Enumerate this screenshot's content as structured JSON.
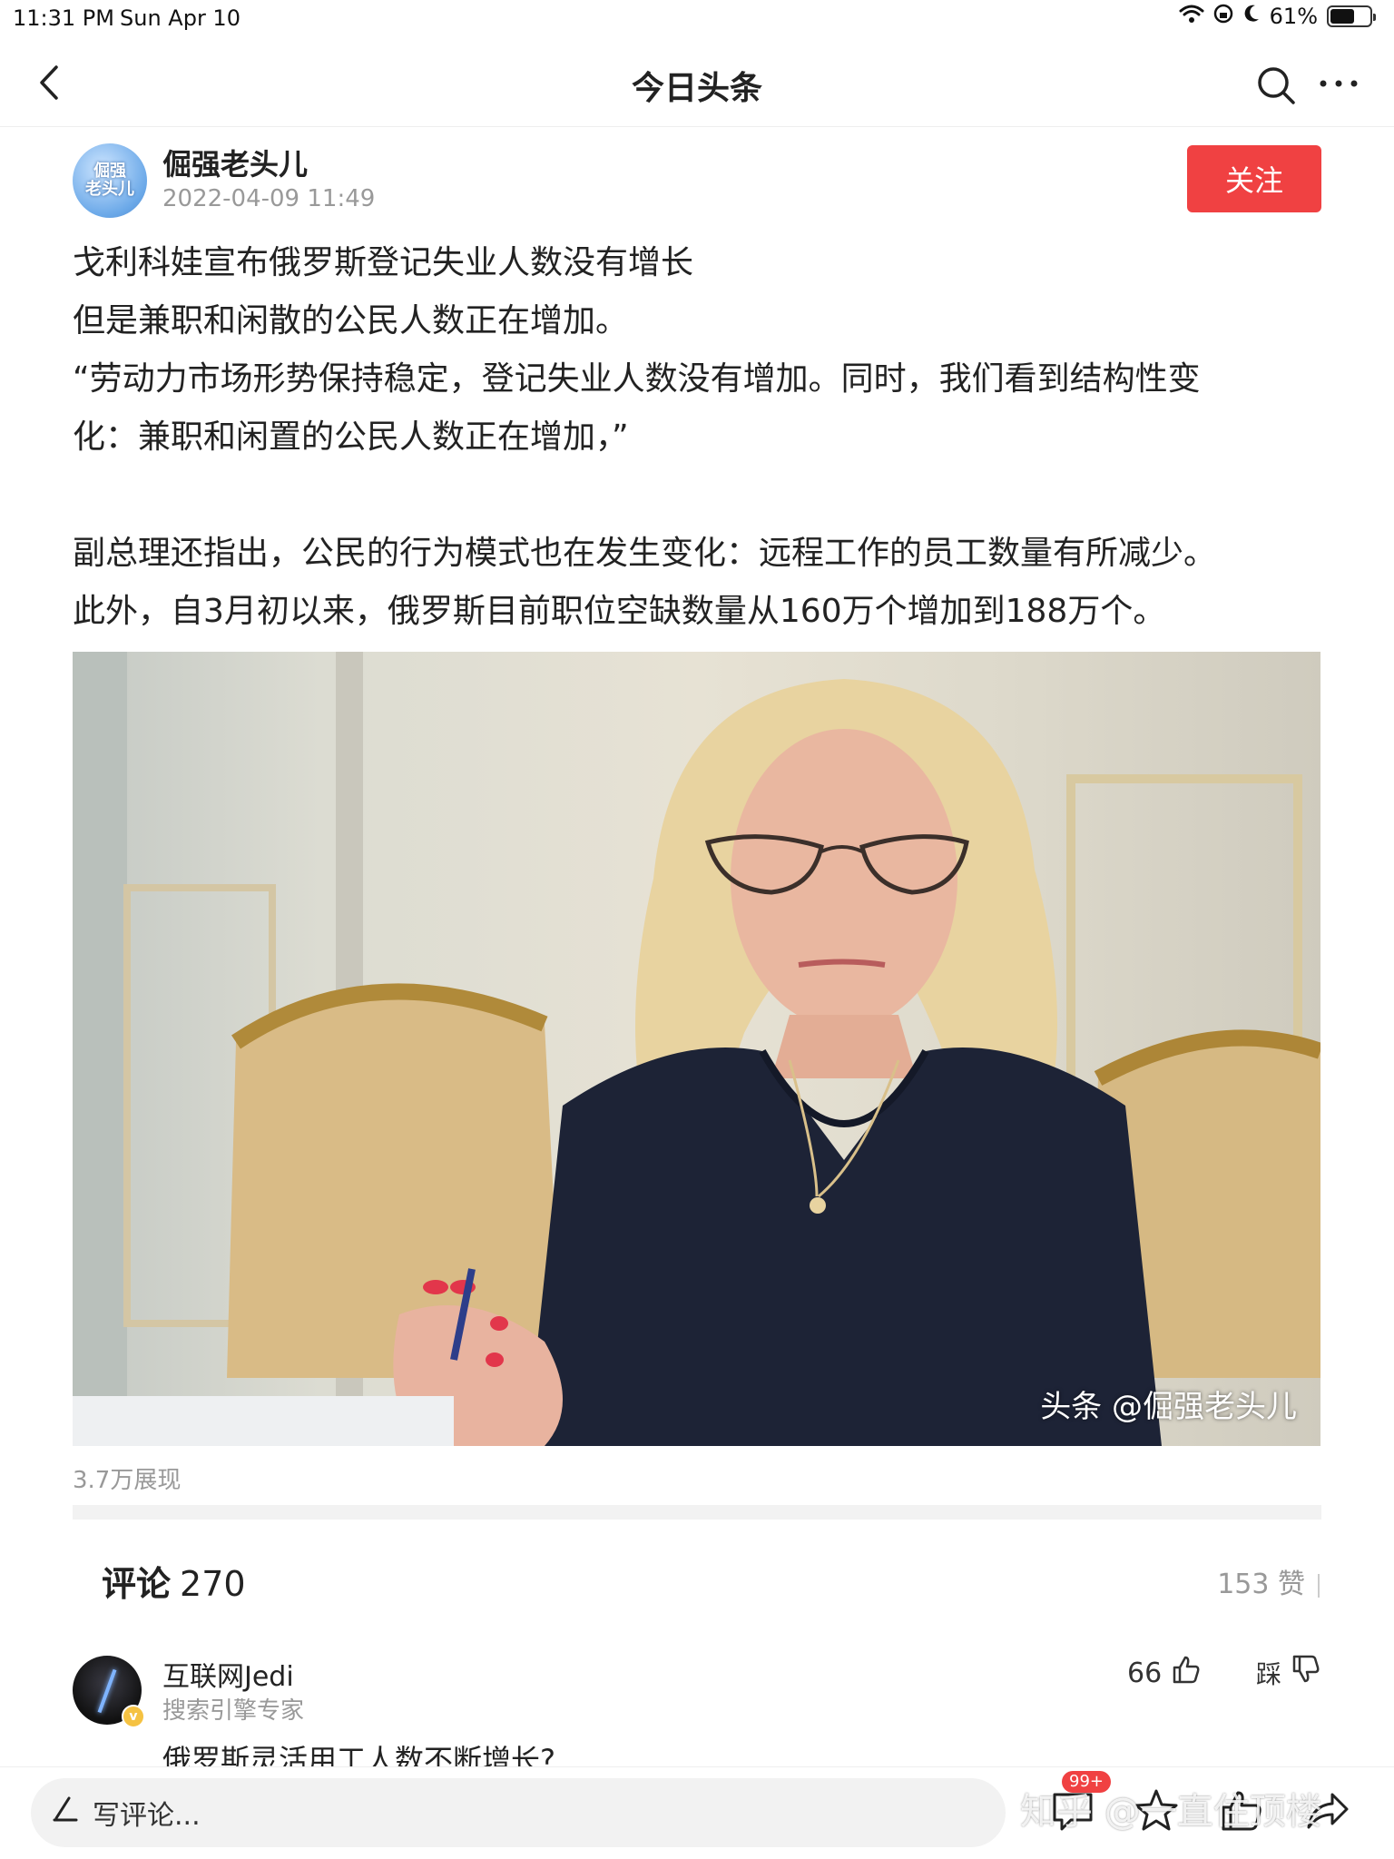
{
  "status_bar": {
    "time": "11:31 PM",
    "date": "Sun Apr 10",
    "battery": "61%",
    "battery_level": 0.61
  },
  "nav": {
    "title": "今日头条"
  },
  "author": {
    "avatar_text_line1": "倔强",
    "avatar_text_line2": "老头儿",
    "name": "倔强老头儿",
    "date": "2022-04-09 11:49",
    "follow_label": "关注"
  },
  "article": {
    "lines": [
      "戈利科娃宣布俄罗斯登记失业人数没有增长",
      "但是兼职和闲散的公民人数正在增加。",
      "“劳动力市场形势保持稳定，登记失业人数没有增加。同时，我们看到结构性变",
      "化：兼职和闲置的公民人数正在增加，”",
      "副总理还指出，公民的行为模式也在发生变化：远程工作的员工数量有所减少。",
      "此外，自3月初以来，俄罗斯目前职位空缺数量从160万个增加到188万个。"
    ],
    "image_watermark": "头条 @倔强老头儿",
    "views": "3.7万展现"
  },
  "comments": {
    "title": "评论",
    "count": "270",
    "likes_total": "153 赞",
    "items": [
      {
        "name": "互联网Jedi",
        "title": "搜索引擎专家",
        "text": "俄罗斯灵活用工人数不断增长?",
        "likes": "66",
        "dislike_label": "踩",
        "verified_mark": "v"
      }
    ]
  },
  "bottom_bar": {
    "comment_placeholder": "写评论...",
    "badge": "99+",
    "watermark": "知乎 @一直住顶楼"
  },
  "colors": {
    "accent_red": "#f04142",
    "muted_text": "#999999"
  }
}
